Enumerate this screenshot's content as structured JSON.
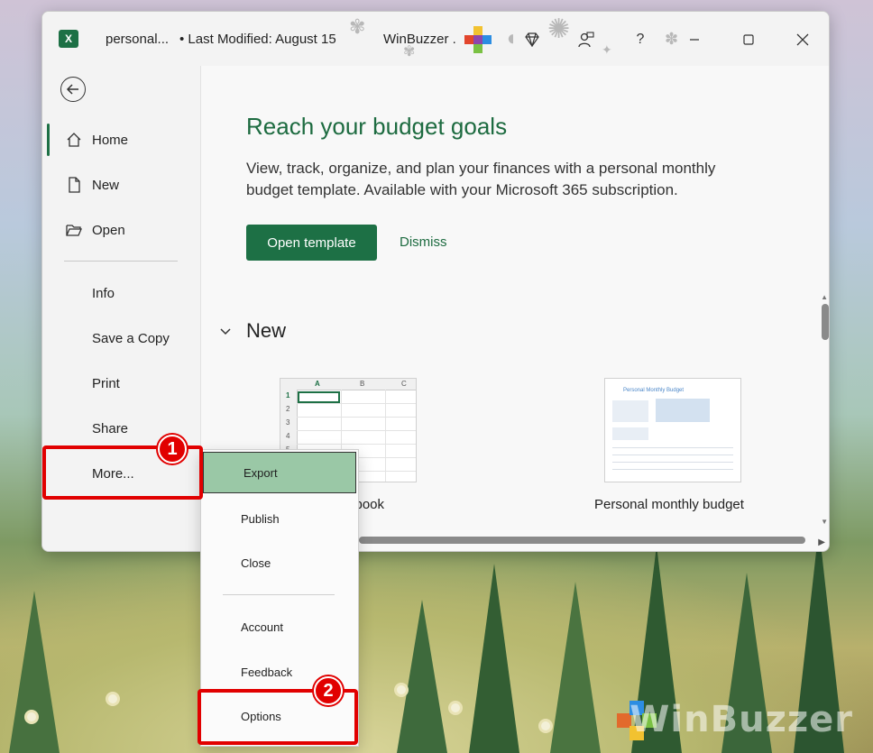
{
  "window": {
    "file_name": "personal...",
    "last_modified": "• Last Modified: August 15",
    "user_name": "WinBuzzer .",
    "help_label": "?"
  },
  "nav": {
    "items": [
      {
        "label": "Home"
      },
      {
        "label": "New"
      },
      {
        "label": "Open"
      },
      {
        "label": "Info"
      },
      {
        "label": "Save a Copy"
      },
      {
        "label": "Print"
      },
      {
        "label": "Share"
      },
      {
        "label": "More..."
      }
    ]
  },
  "promo": {
    "title": "Reach your budget goals",
    "body": "View, track, organize, and plan your finances with a personal monthly budget template. Available with your Microsoft 365 subscription.",
    "open_label": "Open template",
    "dismiss_label": "Dismiss"
  },
  "new_section": {
    "title": "New",
    "templates": [
      {
        "label": "kbook"
      },
      {
        "label": "Personal monthly budget"
      }
    ],
    "blank_grid": {
      "columns": [
        "A",
        "B",
        "C"
      ],
      "rows": [
        "1",
        "2",
        "3",
        "4",
        "5"
      ]
    },
    "budget_thumb_title": "Personal Monthly Budget"
  },
  "flyout": {
    "items": [
      {
        "label": "Export"
      },
      {
        "label": "Publish"
      },
      {
        "label": "Close"
      },
      {
        "label": "Account"
      },
      {
        "label": "Feedback"
      },
      {
        "label": "Options"
      }
    ]
  },
  "callouts": {
    "step1": "1",
    "step2": "2"
  },
  "watermark": {
    "text": "WinBuzzer"
  },
  "colors": {
    "excel_green": "#1d7045",
    "highlight": "#9ac8a6",
    "callout_red": "#e10000"
  }
}
